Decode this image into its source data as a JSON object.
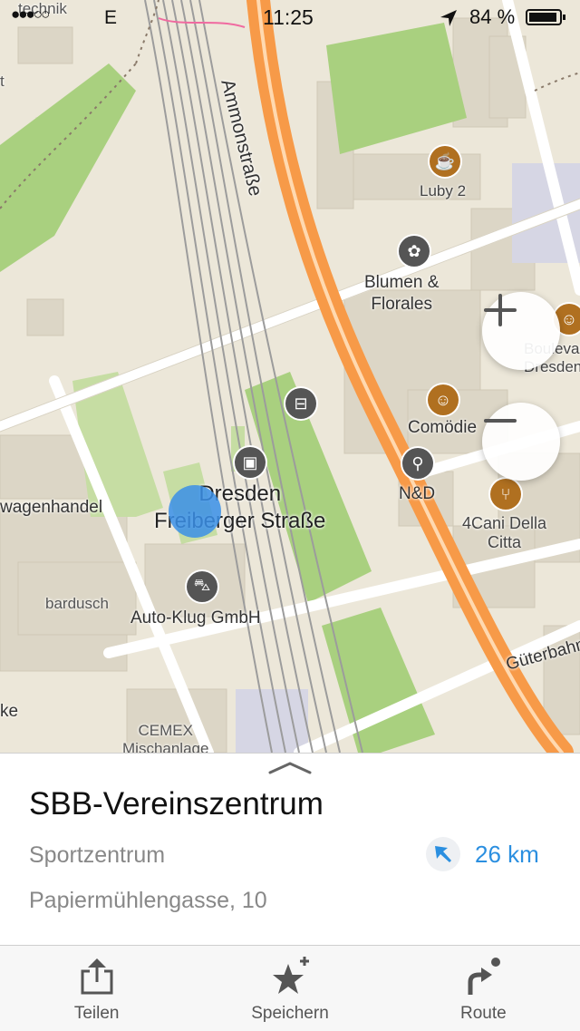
{
  "status_bar": {
    "carrier": "●●●○○",
    "network": "E",
    "time": "11:25",
    "battery": "84 %"
  },
  "map": {
    "streets": {
      "ammon": "Ammonstraße",
      "gueter": "Güterbahnhofstraße"
    },
    "pois": {
      "luby": "Luby 2",
      "blumen": "Blumen &\nFlorales",
      "boulevard": "Boulevard\nDresden",
      "comoedie": "Comödie",
      "nd": "N&D",
      "cani": "4Cani Della\nCitta",
      "station": "Dresden\nFreiberger Straße",
      "wagenhandel": "wagenhandel",
      "bardusch": "bardusch",
      "autoklug": "Auto-Klug GmbH",
      "cemex": "CEMEX\nMischanlage",
      "technik": "technik",
      "ke": "ke",
      "t": "t"
    },
    "icons": {
      "coffee": "coffee-icon",
      "flower": "flower-icon",
      "theatre": "theatre-icon",
      "tram": "tram-icon",
      "train": "train-icon",
      "shirt": "shirt-icon",
      "restaurant": "restaurant-icon",
      "car": "car-icon"
    },
    "colors": {
      "road": "#f79a48",
      "park": "#a9d07f",
      "land": "#ece7d9",
      "location": "#3a8fe8"
    }
  },
  "sheet": {
    "title": "SBB-Vereinszentrum",
    "category": "Sportzentrum",
    "address": "Papiermühlengasse, 10",
    "distance": "26 km",
    "accent": "#2b8fe0"
  },
  "tabbar": {
    "share": "Teilen",
    "save": "Speichern",
    "route": "Route"
  }
}
